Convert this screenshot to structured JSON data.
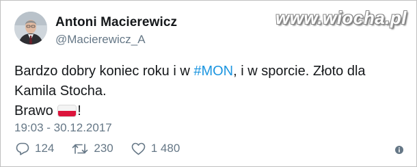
{
  "author": {
    "name": "Antoni Macierewicz",
    "handle": "@Macierewicz_A"
  },
  "watermark": "www.wiocha.pl",
  "tweet": {
    "line1_before": "Bardzo dobry koniec roku i w ",
    "hashtag": "#MON",
    "line1_after": ", i w sporcie. Złoto dla",
    "line2": "Kamila Stocha.",
    "line3_before": "Brawo ",
    "line3_after": "!"
  },
  "timestamp": "19:03 - 30.12.2017",
  "actions": {
    "replies": "124",
    "retweets": "230",
    "likes": "1 480"
  },
  "colors": {
    "hashtag": "#1b95e0",
    "meta_text": "#657786",
    "flag_red": "#dc143c"
  },
  "icons": [
    "reply-icon",
    "retweet-icon",
    "like-icon",
    "info-icon",
    "poland-flag-emoji"
  ]
}
